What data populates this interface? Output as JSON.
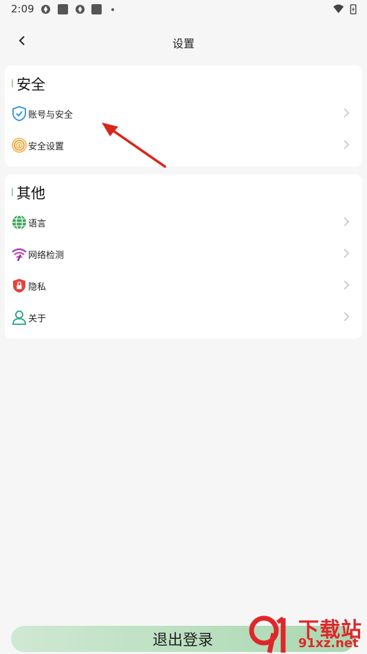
{
  "status_bar": {
    "time": "2:09"
  },
  "header": {
    "title": "设置"
  },
  "sections": {
    "security": {
      "title": "安全",
      "items": [
        {
          "label": "账号与安全",
          "icon": "shield-icon"
        },
        {
          "label": "安全设置",
          "icon": "fingerprint-icon"
        }
      ]
    },
    "other": {
      "title": "其他",
      "items": [
        {
          "label": "语言",
          "icon": "globe-icon"
        },
        {
          "label": "网络检测",
          "icon": "wifi-icon"
        },
        {
          "label": "隐私",
          "icon": "lock-shield-icon"
        },
        {
          "label": "关于",
          "icon": "person-icon"
        }
      ]
    }
  },
  "logout": {
    "label": "退出登录"
  },
  "watermark": {
    "line1": "下载站",
    "line2": "91xz.net"
  },
  "colors": {
    "accent_green": "#a9d8b0",
    "annotation_red": "#d9261c"
  }
}
